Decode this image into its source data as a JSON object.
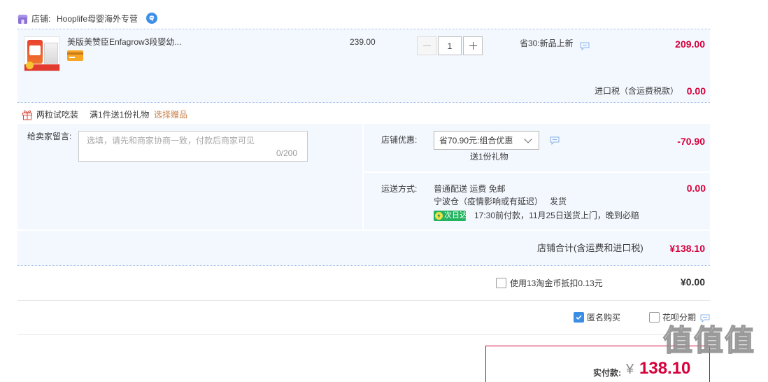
{
  "colors": {
    "accent_red": "#d6003a",
    "blue": "#3a8ee6",
    "green": "#22b35e",
    "link_brown": "#c8814b",
    "panel_bg": "#f3f7fe"
  },
  "store": {
    "label": "店铺:",
    "name": "Hooplife母婴海外专营",
    "icon": "shop-icon",
    "badge_icon": "wangwang-chat-icon"
  },
  "item": {
    "image_icon": "product-image",
    "title": "美版美赞臣Enfagrow3段婴幼...",
    "card_icon": "credit-card-icon",
    "price": "239.00",
    "quantity": "1",
    "promo": "省30:新品上新",
    "subtotal": "209.00",
    "import_tax_label": "进口税（含运费税款）",
    "import_tax_value": "0.00"
  },
  "gift": {
    "icon": "gift-icon",
    "name": "两粒试吃装",
    "rule": "满1件送1份礼物",
    "select_link": "选择赠品"
  },
  "message": {
    "label": "给卖家留言:",
    "placeholder": "选填，请先和商家协商一致，付款后商家可见",
    "counter": "0/200"
  },
  "discount": {
    "label": "店铺优惠:",
    "selected": "省70.90元:组合优惠",
    "note": "送1份礼物",
    "value": "-70.90"
  },
  "shipping": {
    "label": "运送方式:",
    "method": "普通配送 运费 免邮",
    "warehouse": "宁波仓（疫情影响或有延迟）",
    "ship_word": "发货",
    "badge": "次日达",
    "promise": "17:30前付款，11月25日送货上门，晚到必赔",
    "value": "0.00"
  },
  "store_total": {
    "label": "店铺合计(含运费和进口税)",
    "value": "¥138.10"
  },
  "coins": {
    "label": "使用13淘金币抵扣0.13元",
    "checked": false,
    "value": "¥0.00"
  },
  "options": {
    "anonymous_label": "匿名购买",
    "anonymous_checked": true,
    "huabei_label": "花呗分期",
    "huabei_checked": false
  },
  "payment": {
    "label": "实付款:",
    "currency": "¥",
    "amount": "138.10"
  },
  "watermark": "值值值"
}
